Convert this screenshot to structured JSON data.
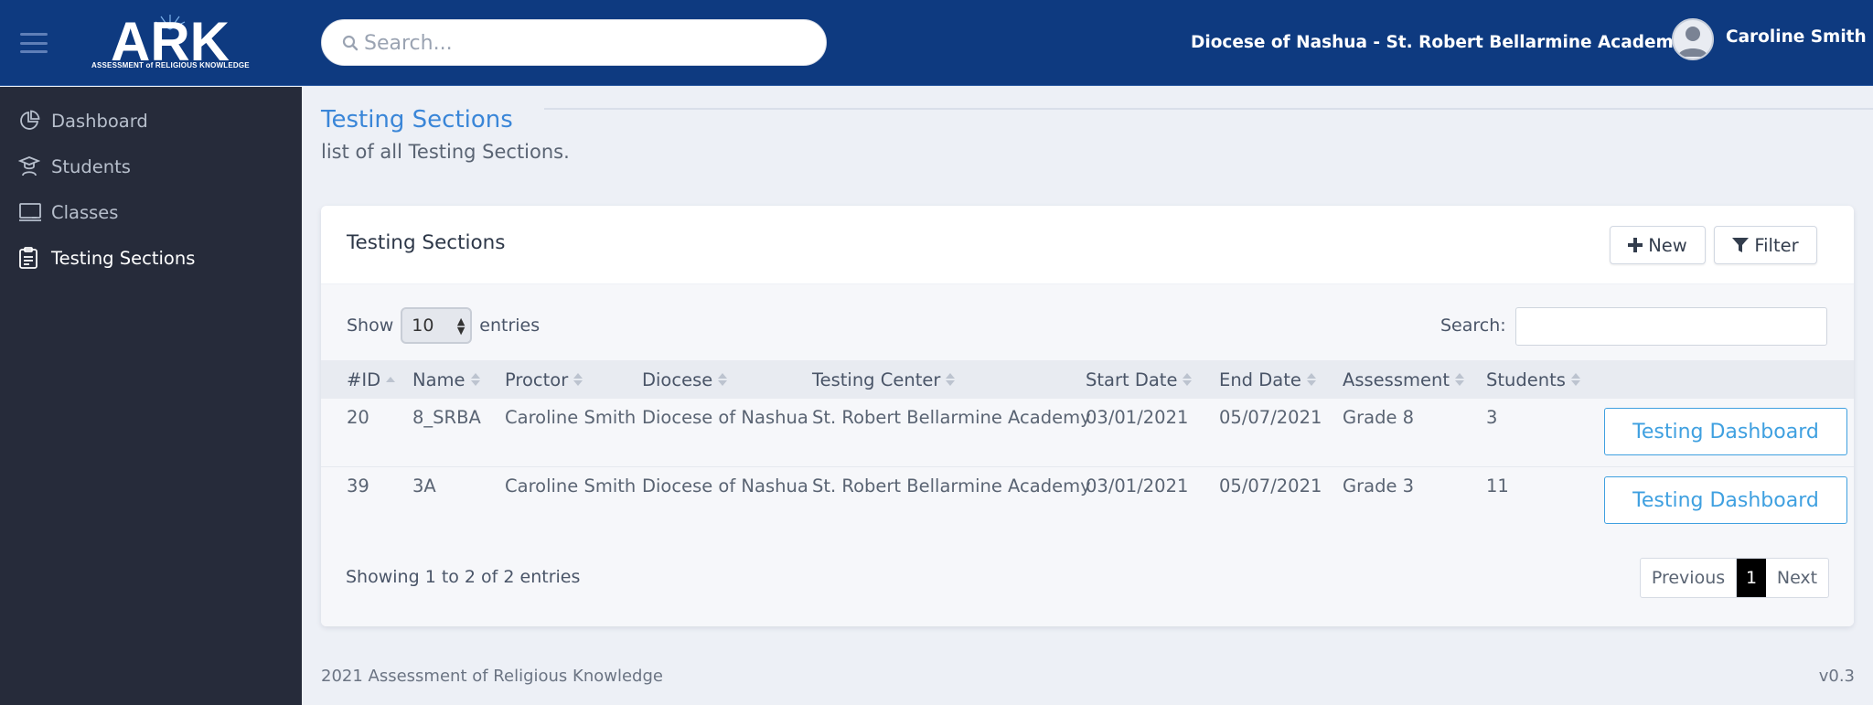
{
  "header": {
    "logo_text": "ARK",
    "logo_subtitle": "ASSESSMENT of RELIGIOUS KNOWLEDGE",
    "search_placeholder": "Search...",
    "organization": "Diocese of Nashua - St. Robert Bellarmine Academy",
    "user_name": "Caroline Smith",
    "brand_color": "#0e3a80"
  },
  "sidebar": {
    "items": [
      {
        "label": "Dashboard",
        "icon": "pie-chart-icon",
        "active": false
      },
      {
        "label": "Students",
        "icon": "graduation-cap-icon",
        "active": false
      },
      {
        "label": "Classes",
        "icon": "chalkboard-icon",
        "active": false
      },
      {
        "label": "Testing Sections",
        "icon": "clipboard-icon",
        "active": true
      }
    ]
  },
  "page": {
    "title": "Testing Sections",
    "subtitle": "list of all Testing Sections."
  },
  "card": {
    "title": "Testing Sections",
    "new_label": "New",
    "filter_label": "Filter"
  },
  "table": {
    "show_label": "Show",
    "entries_label": "entries",
    "page_length": "10",
    "search_label": "Search:",
    "search_value": "",
    "columns": [
      "#ID",
      "Name",
      "Proctor",
      "Diocese",
      "Testing Center",
      "Start Date",
      "End Date",
      "Assessment",
      "Students"
    ],
    "rows": [
      {
        "id": "20",
        "name": "8_SRBA",
        "proctor": "Caroline Smith",
        "diocese": "Diocese of Nashua",
        "center": "St. Robert Bellarmine Academy",
        "start": "03/01/2021",
        "end": "05/07/2021",
        "assessment": "Grade 8",
        "students": "3",
        "action": "Testing Dashboard"
      },
      {
        "id": "39",
        "name": "3A",
        "proctor": "Caroline Smith",
        "diocese": "Diocese of Nashua",
        "center": "St. Robert Bellarmine Academy",
        "start": "03/01/2021",
        "end": "05/07/2021",
        "assessment": "Grade 3",
        "students": "11",
        "action": "Testing Dashboard"
      }
    ],
    "info": "Showing 1 to 2 of 2 entries",
    "pagination": {
      "previous": "Previous",
      "current": "1",
      "next": "Next"
    }
  },
  "footer": {
    "copyright": "2021 Assessment of Religious Knowledge",
    "version": "v0.3"
  }
}
